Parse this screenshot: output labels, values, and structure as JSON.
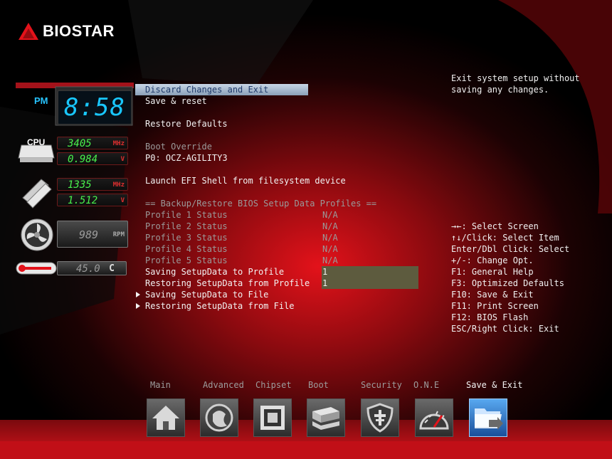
{
  "brand": {
    "name": "BIOSTAR"
  },
  "status": {
    "ampm": "PM",
    "time": "8:58",
    "cpu_label": "CPU",
    "cpu_freq": "3405",
    "cpu_freq_unit": "MHz",
    "cpu_voltage": "0.984",
    "cpu_voltage_unit": "V",
    "mem_freq": "1335",
    "mem_freq_unit": "MHz",
    "mem_voltage": "1.512",
    "mem_voltage_unit": "V",
    "fan_rpm": "989",
    "fan_unit": "RPM",
    "temperature": "45.0",
    "temp_unit": "C"
  },
  "menu": {
    "discard_exit": "Discard Changes and Exit",
    "save_reset": "Save & reset",
    "restore_defaults": "Restore Defaults",
    "boot_override": "Boot Override",
    "boot_device": "P0: OCZ-AGILITY3",
    "launch_efi": "Launch EFI Shell from filesystem device",
    "profiles_header": "== Backup/Restore BIOS Setup Data Profiles ==",
    "profiles": [
      {
        "label": "Profile 1 Status",
        "value": "N/A"
      },
      {
        "label": "Profile 2 Status",
        "value": "N/A"
      },
      {
        "label": "Profile 3 Status",
        "value": "N/A"
      },
      {
        "label": "Profile 4 Status",
        "value": "N/A"
      },
      {
        "label": "Profile 5 Status",
        "value": "N/A"
      }
    ],
    "saving_to_profile": {
      "label": "Saving SetupData to Profile",
      "value": "1"
    },
    "restoring_from_profile": {
      "label": "Restoring SetupData from Profile",
      "value": "1"
    },
    "saving_to_file": "Saving SetupData to File",
    "restoring_from_file": "Restoring SetupData from File"
  },
  "help": {
    "description": "Exit system setup without saving any changes.",
    "keys": [
      "→←: Select Screen",
      "↑↓/Click: Select Item",
      "Enter/Dbl Click: Select",
      "+/-: Change Opt.",
      "F1: General Help",
      "F3: Optimized Defaults",
      "F10: Save & Exit",
      "F11: Print Screen",
      "F12: BIOS Flash",
      "ESC/Right Click: Exit"
    ]
  },
  "nav": {
    "tabs": [
      {
        "label": "Main",
        "icon": "home-icon"
      },
      {
        "label": "Advanced",
        "icon": "advanced-icon"
      },
      {
        "label": "Chipset",
        "icon": "chip-icon"
      },
      {
        "label": "Boot",
        "icon": "drive-icon"
      },
      {
        "label": "Security",
        "icon": "shield-icon"
      },
      {
        "label": "O.N.E",
        "icon": "gauge-icon"
      },
      {
        "label": "Save & Exit",
        "icon": "folder-exit-icon"
      }
    ],
    "active": "Save & Exit"
  },
  "colors": {
    "selection": "#9db0c6",
    "value_box": "#5d5b3e",
    "accent_red": "#c8101a",
    "lcd_green": "#49f04c",
    "clock_cyan": "#19c7ff"
  }
}
